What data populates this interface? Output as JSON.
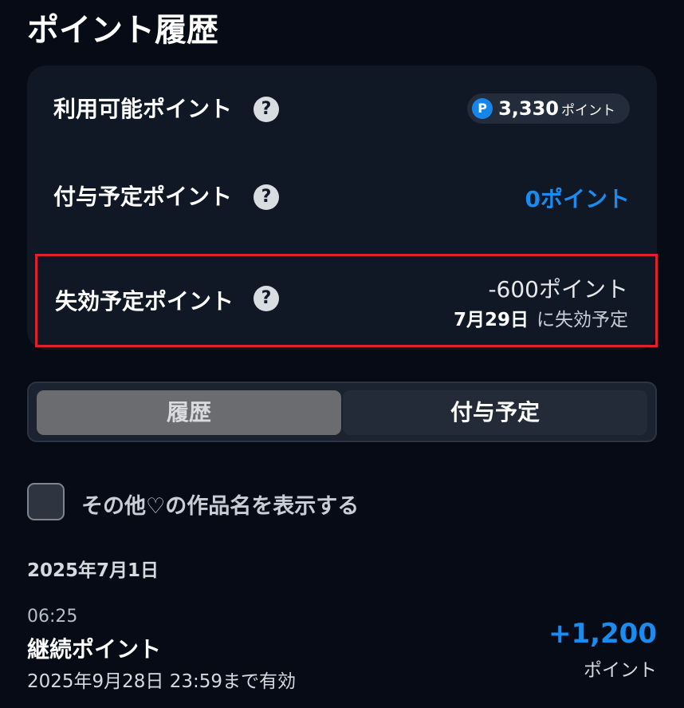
{
  "page": {
    "title": "ポイント履歴"
  },
  "summary": {
    "available": {
      "label": "利用可能ポイント",
      "help_icon": "question-circle-icon",
      "badge_icon_text": "P",
      "value": "3,330",
      "unit": "ポイント"
    },
    "scheduled": {
      "label": "付与予定ポイント",
      "help_icon": "question-circle-icon",
      "value": "0ポイント"
    },
    "expiring": {
      "label": "失効予定ポイント",
      "help_icon": "question-circle-icon",
      "value": "-600ポイント",
      "date": "7月29日",
      "date_suffix": "に失効予定"
    }
  },
  "tabs": [
    {
      "label": "履歴",
      "active": true
    },
    {
      "label": "付与予定",
      "active": false
    }
  ],
  "filter": {
    "checkbox_label": "その他♡の作品名を表示する",
    "checked": false
  },
  "history": {
    "date_heading": "2025年7月1日",
    "items": [
      {
        "time": "06:25",
        "title": "継続ポイント",
        "expiry": "2025年9月28日 23:59まで有効",
        "amount": "+1,200",
        "unit": "ポイント"
      }
    ]
  },
  "colors": {
    "background": "#060b16",
    "card": "#111825",
    "accent_blue": "#1a8cf0",
    "highlight_red": "#e0202a"
  }
}
